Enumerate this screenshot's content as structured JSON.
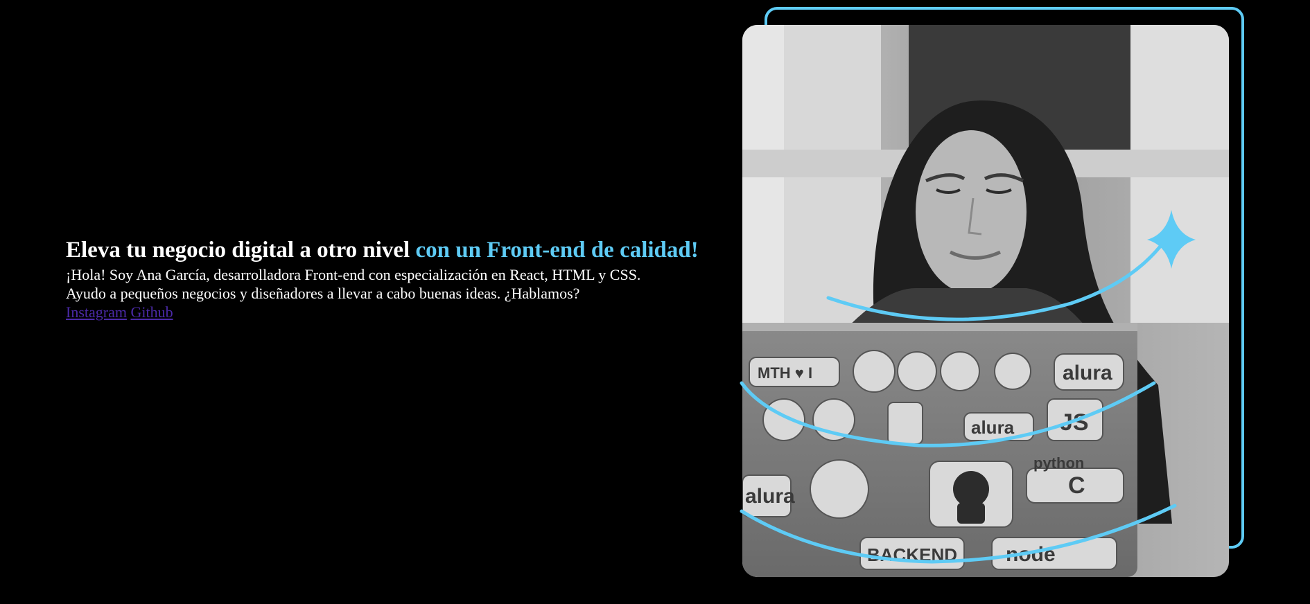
{
  "hero": {
    "title_main": "Eleva tu negocio digital a otro nivel ",
    "title_accent": "con un Front-end de calidad!",
    "description_line1": "¡Hola! Soy Ana García, desarrolladora Front-end con especialización en React, HTML y CSS.",
    "description_line2": "Ayudo a pequeños negocios y diseñadores a llevar a cabo buenas ideas. ¿Hablamos?",
    "links": [
      {
        "label": "Instagram"
      },
      {
        "label": "Github"
      }
    ]
  },
  "photo": {
    "alt": "Mujer sonriendo frente a una laptop con stickers",
    "sticker_texts": [
      "MTH ♥ I",
      "alura",
      "alura",
      "JS",
      "python",
      "alura",
      "BACKEND",
      "node",
      "C"
    ]
  },
  "colors": {
    "background": "#000000",
    "accent": "#5ecbf5",
    "link": "#4b2aa8",
    "text": "#ffffff"
  }
}
